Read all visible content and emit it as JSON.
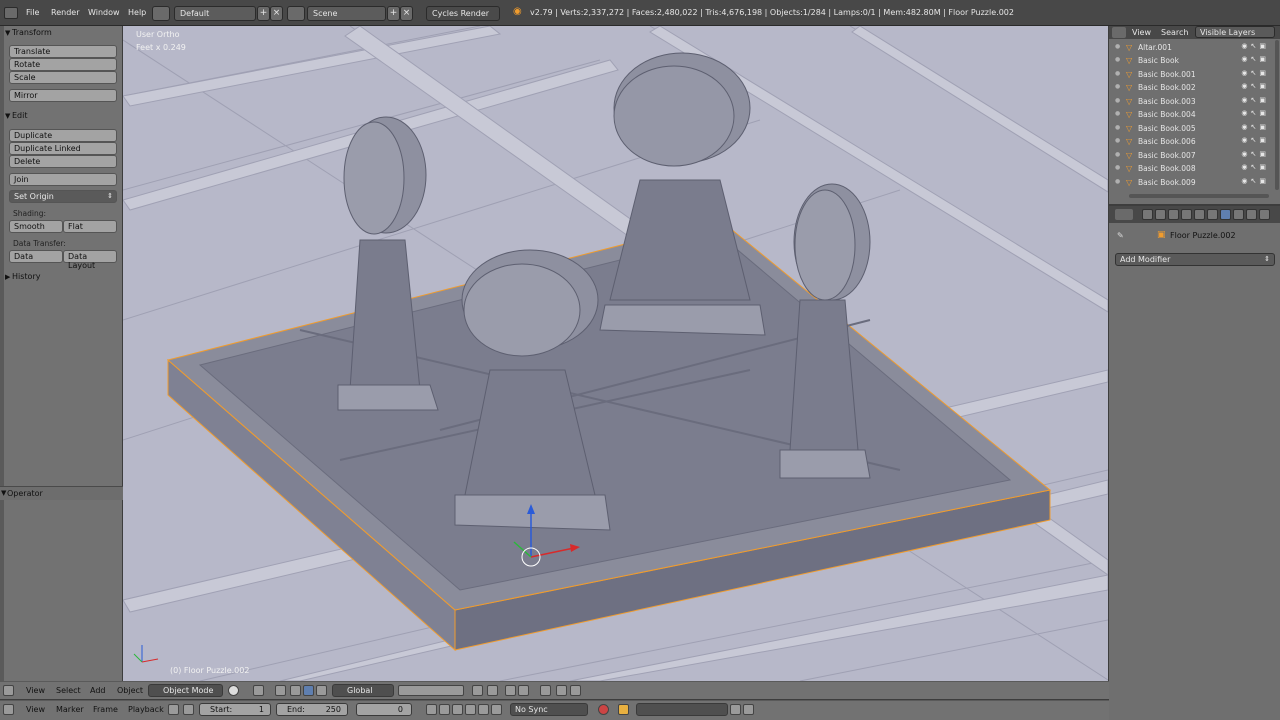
{
  "topbar": {
    "menus": [
      "File",
      "Render",
      "Window",
      "Help"
    ],
    "screen_layout": "Default",
    "scene": "Scene",
    "render_engine": "Cycles Render",
    "stats": "v2.79 | Verts:2,337,272 | Faces:2,480,022 | Tris:4,676,198 | Objects:1/284 | Lamps:0/1 | Mem:482.80M | Floor Puzzle.002"
  },
  "toolpanel": {
    "transform_header": "Transform",
    "translate": "Translate",
    "rotate": "Rotate",
    "scale": "Scale",
    "mirror": "Mirror",
    "edit_header": "Edit",
    "duplicate": "Duplicate",
    "duplicate_linked": "Duplicate Linked",
    "delete": "Delete",
    "join": "Join",
    "set_origin": "Set Origin",
    "shading_label": "Shading:",
    "smooth": "Smooth",
    "flat": "Flat",
    "data_transfer_label": "Data Transfer:",
    "data": "Data",
    "data_layout": "Data Layout",
    "history_header": "History",
    "operator_header": "Operator"
  },
  "viewport": {
    "view_name": "User Ortho",
    "units": "Feet x 0.249",
    "object_label": "(0) Floor Puzzle.002"
  },
  "outliner": {
    "view": "View",
    "search": "Search",
    "display_mode": "Visible Layers",
    "items": [
      {
        "name": "Altar.001"
      },
      {
        "name": "Basic Book"
      },
      {
        "name": "Basic Book.001"
      },
      {
        "name": "Basic Book.002"
      },
      {
        "name": "Basic Book.003"
      },
      {
        "name": "Basic Book.004"
      },
      {
        "name": "Basic Book.005"
      },
      {
        "name": "Basic Book.006"
      },
      {
        "name": "Basic Book.007"
      },
      {
        "name": "Basic Book.008"
      },
      {
        "name": "Basic Book.009"
      }
    ]
  },
  "properties": {
    "object_name": "Floor Puzzle.002",
    "add_modifier": "Add Modifier"
  },
  "bottombar1": {
    "view": "View",
    "select": "Select",
    "add": "Add",
    "object": "Object",
    "mode": "Object Mode",
    "orientation": "Global"
  },
  "bottombar2": {
    "view": "View",
    "marker": "Marker",
    "frame": "Frame",
    "playback": "Playback",
    "start_label": "Start:",
    "start_value": "1",
    "end_label": "End:",
    "end_value": "250",
    "current_frame": "0",
    "sync": "No Sync"
  },
  "colors": {
    "selection_outline": "#f09c2e",
    "viewport_bg": "#b7b8c9",
    "model_fill": "#8a8c9b"
  }
}
